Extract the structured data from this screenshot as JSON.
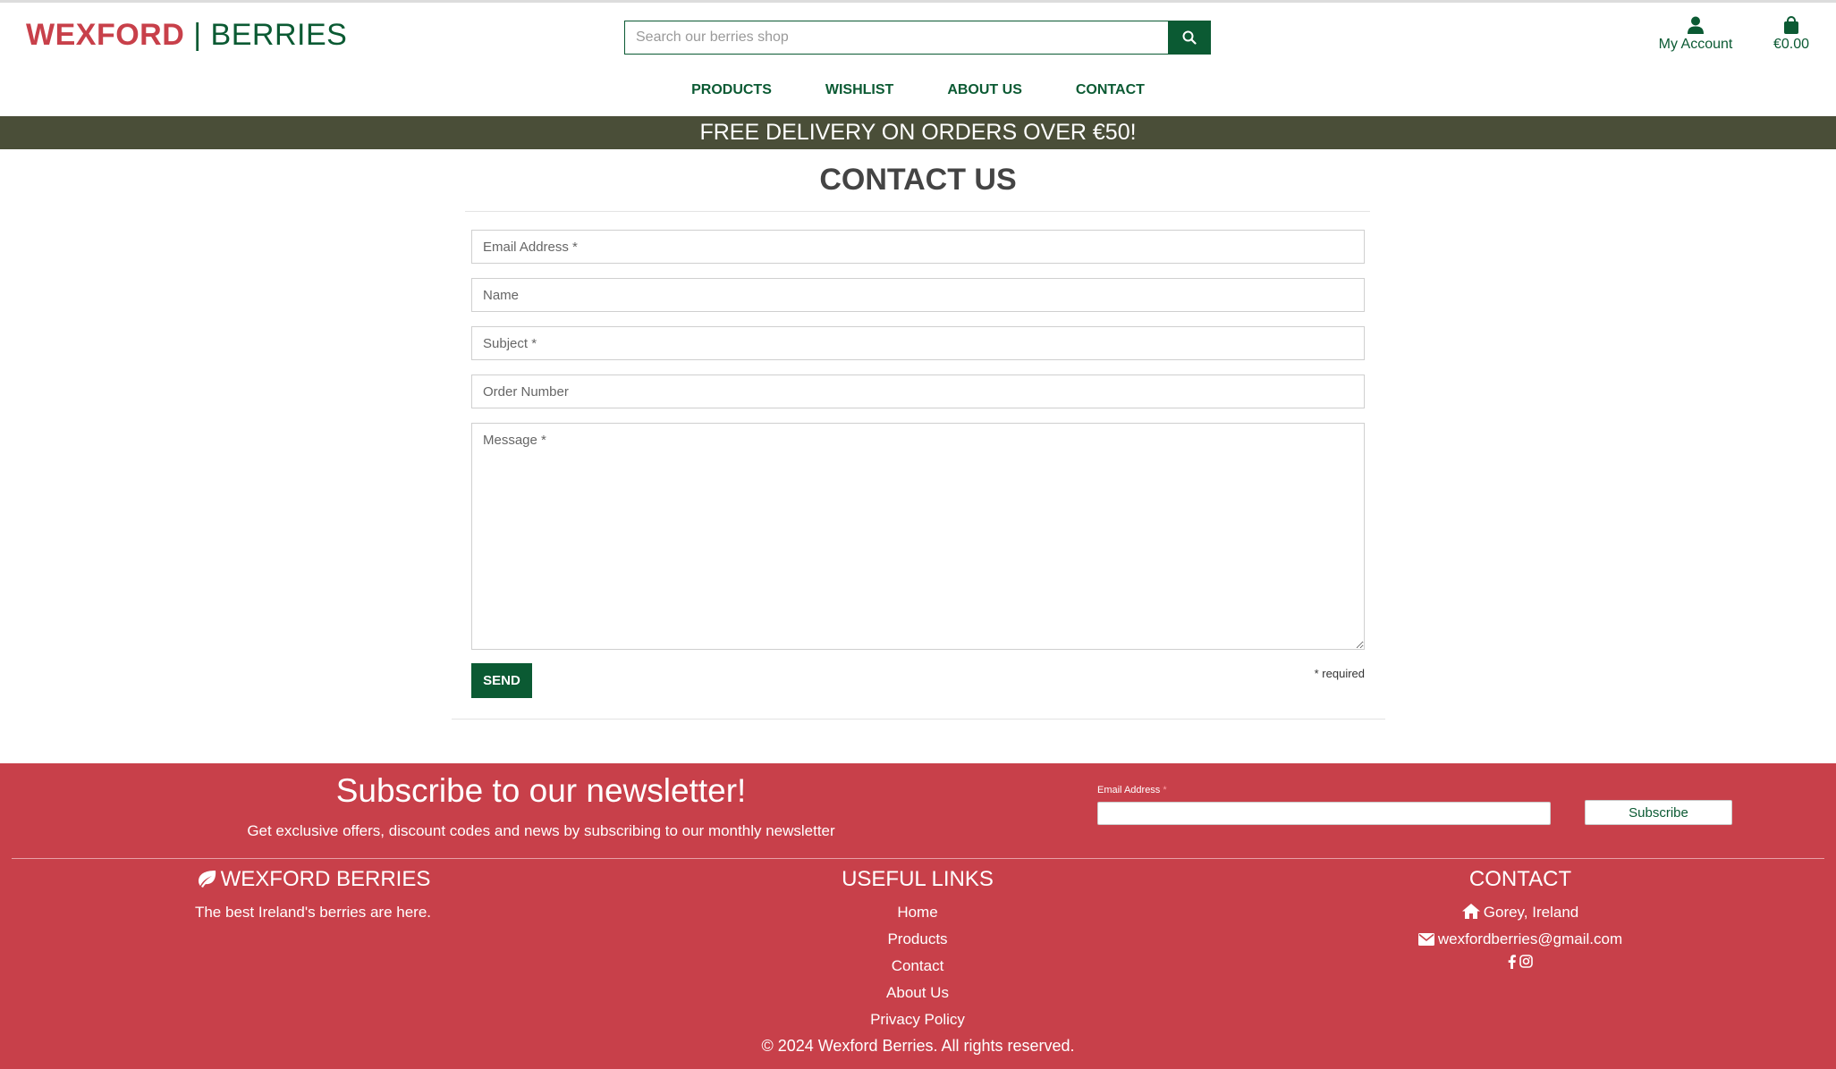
{
  "header": {
    "logo_part1": "WEXFORD",
    "logo_separator": "|",
    "logo_part2": "BERRIES",
    "search_placeholder": "Search our berries shop",
    "search_icon": "search-icon",
    "account_label": "My Account",
    "account_icon": "user-icon",
    "bag_total": "€0.00",
    "bag_icon": "shopping-bag-icon"
  },
  "nav": {
    "items": [
      "PRODUCTS",
      "WISHLIST",
      "ABOUT US",
      "CONTACT"
    ]
  },
  "banner": {
    "text": "FREE DELIVERY ON ORDERS OVER €50!"
  },
  "contact_form": {
    "title": "CONTACT US",
    "email_placeholder": "Email Address *",
    "name_placeholder": "Name",
    "subject_placeholder": "Subject *",
    "order_placeholder": "Order Number",
    "message_placeholder": "Message *",
    "send_label": "SEND",
    "required_note": "* required"
  },
  "newsletter": {
    "title": "Subscribe to our newsletter!",
    "subtitle": "Get exclusive offers, discount codes and news by subscribing to our monthly newsletter",
    "email_label": "Email Address",
    "required_marker": "*",
    "button_label": "Subscribe"
  },
  "footer": {
    "brand_title": "WEXFORD BERRIES",
    "brand_icon": "leaf-icon",
    "brand_tagline": "The best Ireland's berries are here.",
    "links_title": "USEFUL LINKS",
    "links": [
      "Home",
      "Products",
      "Contact",
      "About Us",
      "Privacy Policy"
    ],
    "contact_title": "CONTACT",
    "address": "Gorey, Ireland",
    "address_icon": "home-icon",
    "email": "wexfordberries@gmail.com",
    "email_icon": "envelope-icon",
    "social_icons": [
      "facebook-icon",
      "instagram-icon"
    ],
    "copyright": "© 2024 Wexford Berries. All rights reserved."
  },
  "colors": {
    "brand_red": "#c8404a",
    "brand_green": "#0b5a33",
    "banner_bg": "#4a4e38"
  }
}
